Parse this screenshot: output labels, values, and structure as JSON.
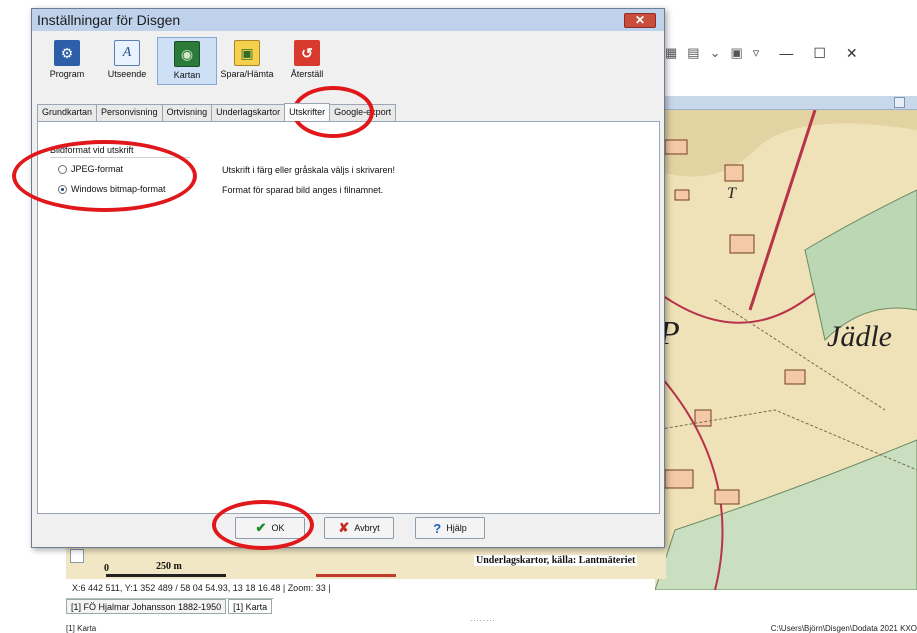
{
  "dialog": {
    "title": "Inställningar för Disgen",
    "close_symbol": "✕",
    "toolbar": [
      {
        "label": "Program",
        "icon": "gear-icon",
        "glyph": "⚙"
      },
      {
        "label": "Utseende",
        "icon": "font-style-icon",
        "glyph": "A"
      },
      {
        "label": "Kartan",
        "icon": "map-icon",
        "glyph": "◉"
      },
      {
        "label": "Spara/Hämta",
        "icon": "folder-save-icon",
        "glyph": "▣"
      },
      {
        "label": "Återställ",
        "icon": "undo-icon",
        "glyph": "↺"
      }
    ],
    "selected_toolbar": "Kartan",
    "tabs": [
      "Grundkartan",
      "Personvisning",
      "Ortvisning",
      "Underlagskartor",
      "Utskrifter",
      "Google-export"
    ],
    "active_tab": "Utskrifter",
    "group_title": "Bildformat vid utskrift",
    "radio_options": [
      {
        "label": "JPEG-format",
        "checked": false
      },
      {
        "label": "Windows bitmap-format",
        "checked": true
      }
    ],
    "info_lines": [
      "Utskrift i färg eller gråskala väljs i skrivaren!",
      "Format för sparad bild anges i filnamnet."
    ],
    "buttons": {
      "ok": {
        "label": "OK",
        "glyph": "✔"
      },
      "cancel": {
        "label": "Avbryt",
        "glyph": "✘"
      },
      "help": {
        "label": "Hjälp",
        "glyph": "?"
      }
    }
  },
  "main_window": {
    "map_labels": [
      "Jädle",
      "T",
      "P"
    ],
    "scale": {
      "zero": "0",
      "distance": "250 m"
    },
    "map_source": "Underlagskartor, källa: Lantmäteriet",
    "coordinates": "X:6 442 511, Y:1 352 489 / 58 04 54.93, 13 18 16.48  |  Zoom: 33  |",
    "bottom_tabs": [
      "[1] FÖ Hjalmar Johansson 1882-1950",
      "[1] Karta"
    ],
    "active_bottom_tab": "[1] Karta",
    "splitter": "........",
    "status_left": "[1] Karta",
    "status_right": "C:\\Users\\Björn\\Disgen\\Dodata 2021 KXO"
  },
  "colors": {
    "annotation_red": "#e0181b",
    "title_bar": "#bfd2ec",
    "close_button": "#c94c3d"
  }
}
